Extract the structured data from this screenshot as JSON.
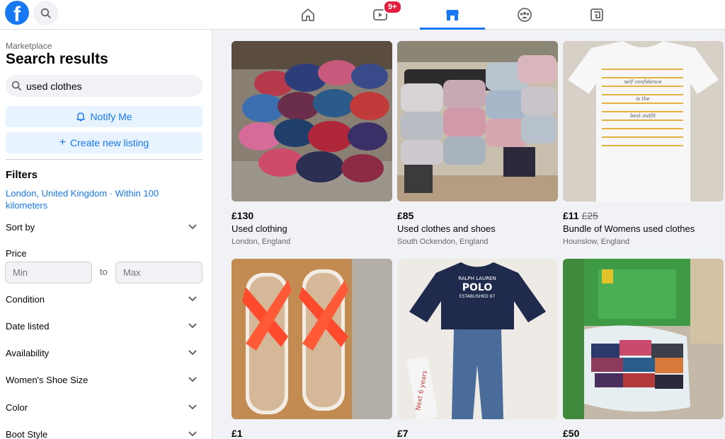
{
  "topbar": {
    "logo_letter": "f",
    "nav": [
      {
        "name": "home",
        "icon": "home-icon"
      },
      {
        "name": "watch",
        "icon": "video-icon",
        "badge": "9+"
      },
      {
        "name": "marketplace",
        "icon": "marketplace-icon",
        "active": true
      },
      {
        "name": "groups",
        "icon": "groups-icon"
      },
      {
        "name": "gaming",
        "icon": "gaming-icon"
      }
    ]
  },
  "sidebar": {
    "breadcrumb": "Marketplace",
    "title": "Search results",
    "search_value": "used clothes",
    "notify_label": "Notify Me",
    "create_label": "Create new listing",
    "filters_heading": "Filters",
    "location": "London, United Kingdom · Within 100 kilometers",
    "sort_by": "Sort by",
    "price_label": "Price",
    "min_placeholder": "Min",
    "to_label": "to",
    "max_placeholder": "Max",
    "filters": [
      "Condition",
      "Date listed",
      "Availability",
      "Women's Shoe Size",
      "Color",
      "Boot Style"
    ]
  },
  "listings": [
    {
      "price": "£130",
      "old_price": "",
      "title": "Used clothing",
      "location": "London, England"
    },
    {
      "price": "£85",
      "old_price": "",
      "title": "Used clothes and shoes",
      "location": "South Ockendon, England"
    },
    {
      "price": "£11",
      "old_price": "£25",
      "title": "Bundle of Womens used clothes",
      "location": "Hounslow, England"
    },
    {
      "price": "£1",
      "old_price": "",
      "title": "",
      "location": ""
    },
    {
      "price": "£7",
      "old_price": "",
      "title": "",
      "location": ""
    },
    {
      "price": "£50",
      "old_price": "",
      "title": "",
      "location": ""
    }
  ],
  "image_text": {
    "shirt_lines": [
      "self confidence",
      "is the",
      "best outfit"
    ],
    "polo_brand": "RALPH LAUREN",
    "polo_word": "POLO",
    "polo_est": "ESTABLISHED 67",
    "tag_text": "Next 6 years"
  },
  "colors": {
    "accent": "#1877f2",
    "badge": "#e41e3f"
  }
}
